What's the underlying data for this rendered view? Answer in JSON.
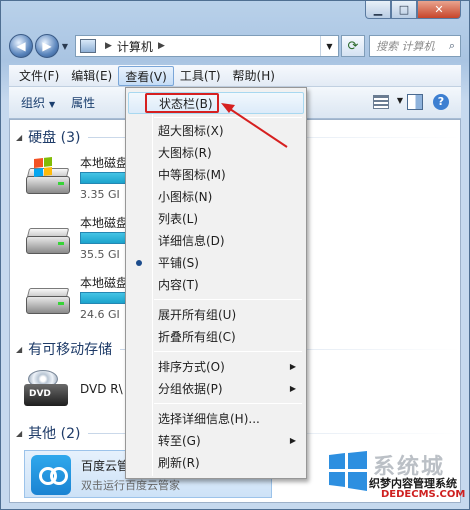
{
  "navigation": {
    "back_glyph": "◀",
    "forward_glyph": "▶",
    "breadcrumb": [
      "计算机"
    ],
    "search_placeholder": "搜索 计算机",
    "search_icon": "search-icon"
  },
  "menubar": {
    "items": [
      {
        "label": "文件(F)"
      },
      {
        "label": "编辑(E)"
      },
      {
        "label": "查看(V)",
        "active": true
      },
      {
        "label": "工具(T)"
      },
      {
        "label": "帮助(H)"
      }
    ]
  },
  "cmdbar": {
    "organize_label": "组织",
    "properties_label": "属性"
  },
  "groups": {
    "hdd": {
      "label": "硬盘 (3)"
    },
    "removable": {
      "label": "有可移动存储"
    },
    "other": {
      "label": "其他 (2)"
    }
  },
  "drives": [
    {
      "name": "本地磁盘",
      "free": "3.35 GI"
    },
    {
      "name": "本地磁盘",
      "free": "35.5 GI"
    },
    {
      "name": "本地磁盘",
      "free": "24.6 GI"
    }
  ],
  "dvd": {
    "name": "DVD R\\",
    "badge": "DVD"
  },
  "cloud": {
    "title": "百度云管",
    "subtitle": "双击运行百度云管家"
  },
  "view_menu": {
    "items": [
      {
        "label": "状态栏(B)"
      },
      {
        "label": "超大图标(X)"
      },
      {
        "label": "大图标(R)"
      },
      {
        "label": "中等图标(M)"
      },
      {
        "label": "小图标(N)"
      },
      {
        "label": "列表(L)"
      },
      {
        "label": "详细信息(D)"
      },
      {
        "label": "平铺(S)"
      },
      {
        "label": "内容(T)"
      },
      {
        "label": "展开所有组(U)"
      },
      {
        "label": "折叠所有组(C)"
      },
      {
        "label": "排序方式(O)"
      },
      {
        "label": "分组依据(P)"
      },
      {
        "label": "选择详细信息(H)..."
      },
      {
        "label": "转至(G)"
      },
      {
        "label": "刷新(R)"
      }
    ],
    "selected_view": "平铺(S)"
  },
  "watermark": {
    "brand": "系统城",
    "site": "织梦内容管理系统",
    "url": "DEDECMS.COM",
    "faint": "xitongcheng.com"
  },
  "colors": {
    "annotation": "#d62020",
    "accent": "#1a83d2"
  }
}
